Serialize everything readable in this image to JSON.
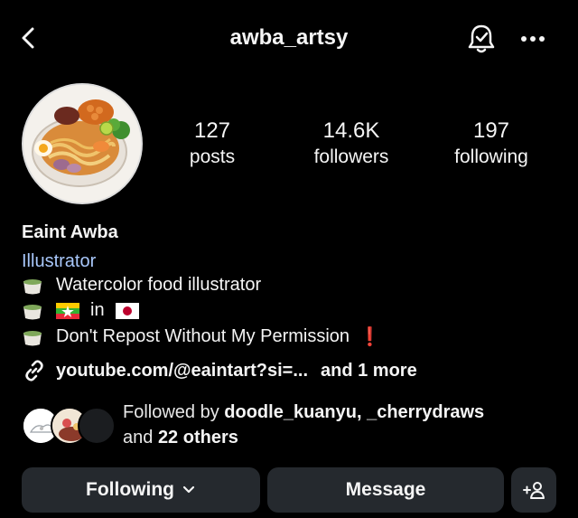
{
  "header": {
    "username": "awba_artsy",
    "icons": [
      "chevron-left-icon",
      "bell-check-icon",
      "more-horizontal-icon"
    ]
  },
  "stats": [
    {
      "value": "127",
      "label": "posts"
    },
    {
      "value": "14.6K",
      "label": "followers"
    },
    {
      "value": "197",
      "label": "following"
    }
  ],
  "profile": {
    "name": "Eaint Awba",
    "category": "Illustrator",
    "bio": {
      "line1": "Watercolor food illustrator",
      "line2_in": "in",
      "line3": "Don't Repost Without My Permission",
      "line3_mark": "❗"
    },
    "link": {
      "url": "youtube.com/@eaintart?si=...",
      "more": "and 1 more"
    }
  },
  "followed_by": {
    "prefix": "Followed by",
    "names": "doodle_kuanyu, _cherrydraws",
    "and": "and",
    "others": "22 others"
  },
  "actions": {
    "following": "Following",
    "message": "Message"
  },
  "colors": {
    "background": "#000000",
    "category": "#a8c7fa",
    "button_bg": "#25292e",
    "alert": "#e0303a"
  }
}
